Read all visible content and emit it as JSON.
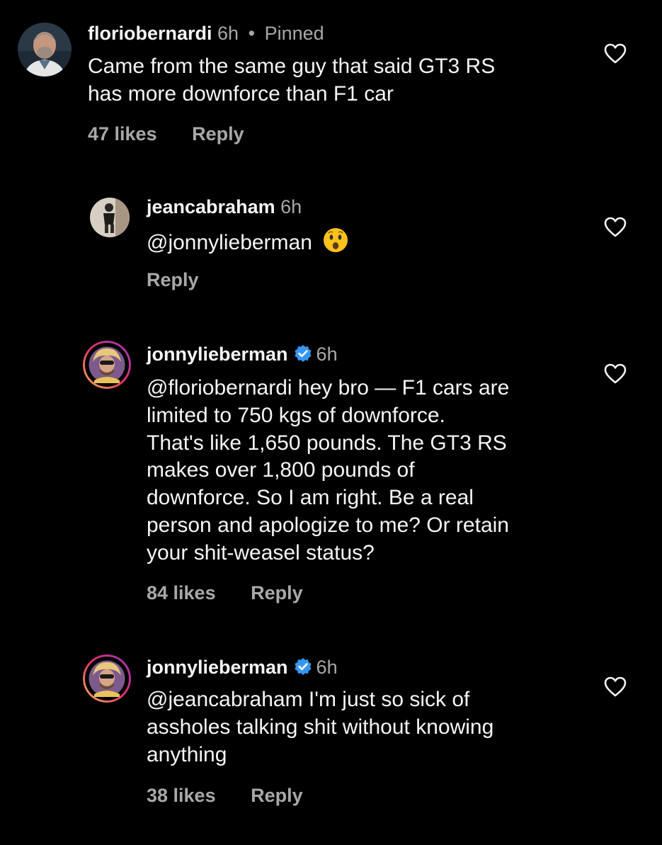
{
  "colors": {
    "background": "#000000",
    "text": "#f5f5f5",
    "muted": "#a8a8a8",
    "verified": "#3797f0"
  },
  "comments": [
    {
      "username": "floriobernardi",
      "time": "6h",
      "separator": "•",
      "pinned": "Pinned",
      "verified": false,
      "lines": [
        "Came from the same guy that said GT3 RS",
        "has more downforce than F1 car"
      ],
      "likes": "47 likes",
      "reply": "Reply",
      "liked": false
    },
    {
      "username": "jeancabraham",
      "time": "6h",
      "verified": false,
      "mention": "@jonnylieberman",
      "emoji": "astonished-face-emoji",
      "likes": "",
      "reply": "Reply",
      "liked": false
    },
    {
      "username": "jonnylieberman",
      "time": "6h",
      "verified": true,
      "lines": [
        "@floriobernardi hey bro — F1 cars are",
        "limited to 750 kgs of downforce.",
        "That's like 1,650 pounds. The GT3 RS",
        "makes over 1,800 pounds of",
        "downforce. So I am right. Be a real",
        "person and apologize to me? Or retain",
        "your shit-weasel status?"
      ],
      "likes": "84 likes",
      "reply": "Reply",
      "liked": false
    },
    {
      "username": "jonnylieberman",
      "time": "6h",
      "verified": true,
      "lines": [
        "@jeancabraham I'm just so sick of",
        "assholes talking shit without knowing",
        "anything"
      ],
      "likes": "38 likes",
      "reply": "Reply",
      "liked": false
    }
  ]
}
